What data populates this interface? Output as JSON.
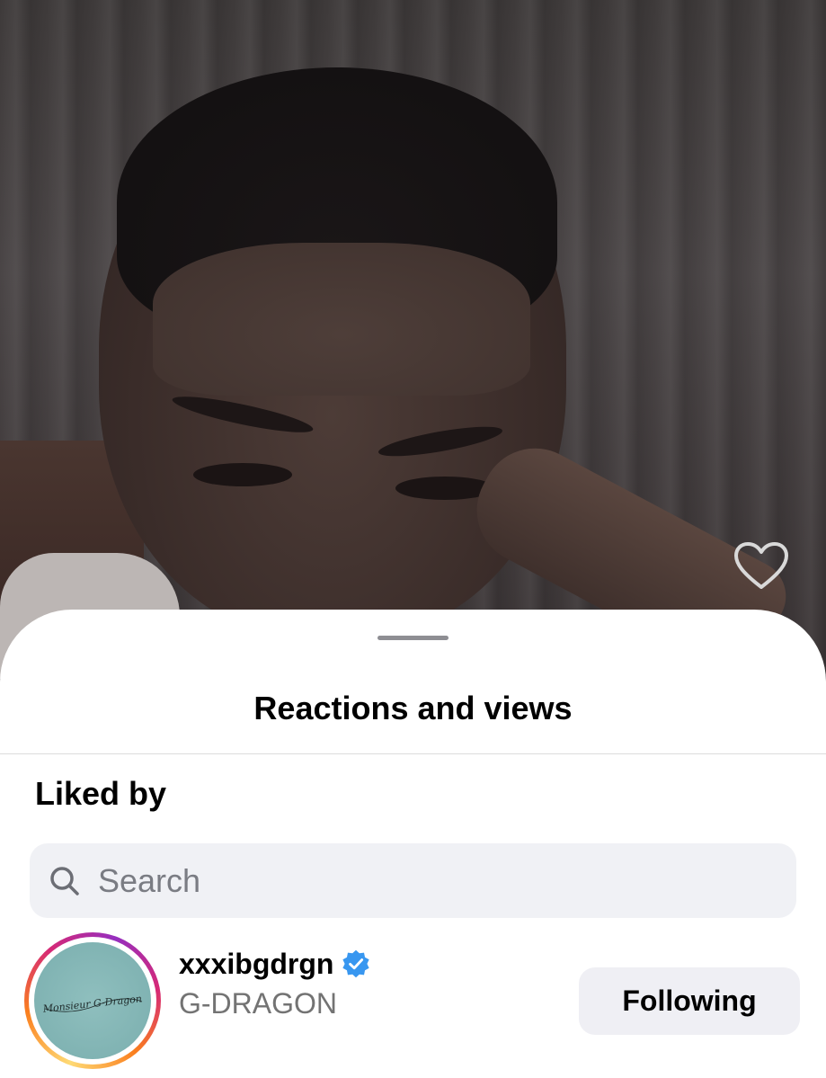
{
  "sheet": {
    "title": "Reactions and views",
    "section_label": "Liked by"
  },
  "search": {
    "placeholder": "Search"
  },
  "users": [
    {
      "username": "xxxibgdrgn",
      "full_name": "G-DRAGON",
      "verified": true,
      "follow_label": "Following",
      "avatar_text": "Monsieur G-Dragon"
    }
  ],
  "icons": {
    "like": "heart-icon",
    "search": "search-icon",
    "verified": "verified-badge-icon"
  },
  "colors": {
    "verified": "#3897f0",
    "secondary_text": "#737373",
    "button_bg": "#efeff4",
    "search_bg": "#f0f1f5"
  }
}
